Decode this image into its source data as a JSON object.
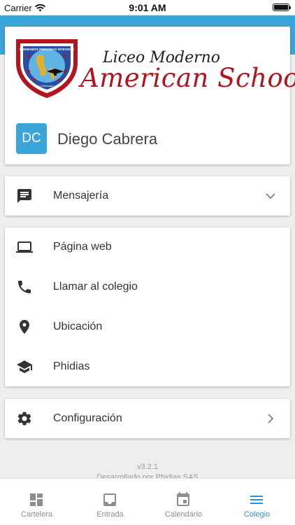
{
  "status_bar": {
    "carrier": "Carrier",
    "time": "9:01 AM"
  },
  "school": {
    "logo_line1": "Liceo Moderno",
    "logo_line2": "American School",
    "crest_text_top": "FORMAMOS PERSONAS INTEGRAS",
    "crest_text_bottom": "Paz, Liderazgo y Fe"
  },
  "user": {
    "initials": "DC",
    "name": "Diego Cabrera"
  },
  "messaging": {
    "label": "Mensajería"
  },
  "links": [
    {
      "label": "Página web",
      "icon": "laptop-icon"
    },
    {
      "label": "Llamar al colegio",
      "icon": "phone-icon"
    },
    {
      "label": "Ubicación",
      "icon": "location-pin-icon"
    },
    {
      "label": "Phidias",
      "icon": "graduation-cap-icon"
    }
  ],
  "config": {
    "label": "Configuración"
  },
  "footer": {
    "version": "v3.2.1",
    "developer": "Desarrollado por Phidias SAS"
  },
  "tabs": [
    {
      "label": "Cartelera",
      "icon": "dashboard-icon",
      "active": false
    },
    {
      "label": "Entrada",
      "icon": "inbox-icon",
      "active": false
    },
    {
      "label": "Calendario",
      "icon": "calendar-icon",
      "active": false
    },
    {
      "label": "Colegio",
      "icon": "menu-icon",
      "active": true
    }
  ],
  "colors": {
    "primary": "#3aa5d8",
    "brand_red": "#b3141e",
    "active_tab": "#2e8fd1"
  }
}
